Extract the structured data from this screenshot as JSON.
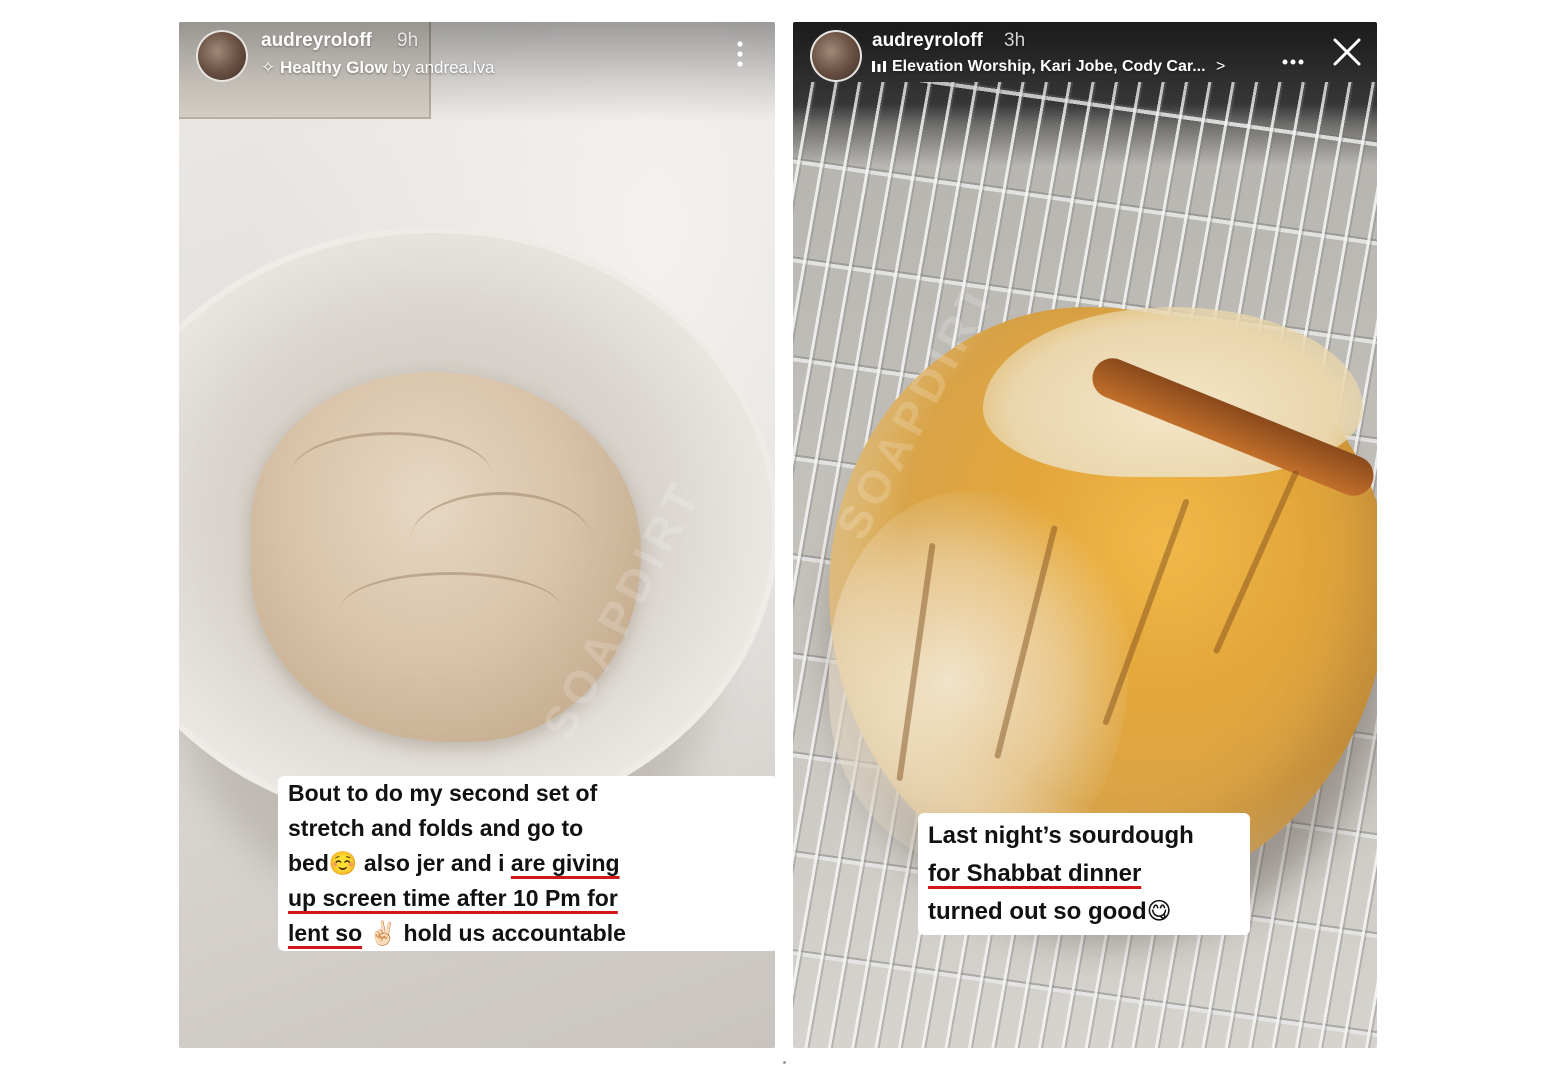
{
  "left_story": {
    "username": "audreyroloff",
    "time": "9h",
    "effect_icon": "sparkle-icon",
    "effect_name": "Healthy Glow",
    "effect_by": "by",
    "effect_author": "andrea.lva",
    "more_icon": "more-vertical-icon",
    "caption": {
      "line1": "Bout to do my second set of",
      "line2": "stretch and folds and go to",
      "line3_plain": "bed☺️ also jer and i ",
      "line3_underlined": "are giving",
      "line4_underlined": "up screen time after 10 Pm for",
      "line5_underlined": "lent so",
      "line5_rest": " ✌🏻 hold us accountable"
    }
  },
  "right_story": {
    "username": "audreyroloff",
    "time": "3h",
    "music_icon": "music-bars-icon",
    "music_text": "Elevation Worship, Kari Jobe, Cody Car...",
    "music_chevron": ">",
    "more_icon": "more-horizontal-icon",
    "close_icon": "close-icon",
    "caption": {
      "line1": "Last night’s sourdough",
      "line2_underlined": "for Shabbat dinner",
      "line3": "turned out so good😋"
    }
  },
  "colors": {
    "underline": "#d01818",
    "caption_bg": "#ffffff",
    "caption_text": "#111111"
  }
}
